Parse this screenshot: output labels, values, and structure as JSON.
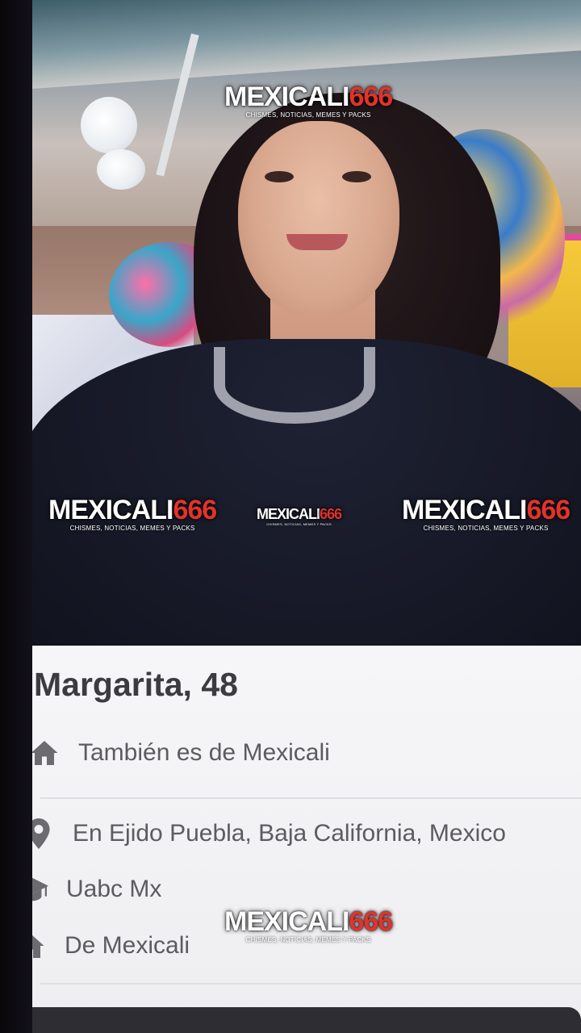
{
  "watermark": {
    "brand_word": "MEXICALI",
    "brand_number": "666",
    "tagline": "CHISMES, NOTICIAS, MEMES Y PACKS"
  },
  "profile": {
    "name_age": "Margarita, 48",
    "details": [
      {
        "icon": "home-icon",
        "text": "También es de Mexicali"
      },
      {
        "icon": "location-pin-icon",
        "text": "En Ejido Puebla, Baja California, Mexico"
      },
      {
        "icon": "graduation-cap-icon",
        "text": "Uabc Mx"
      },
      {
        "icon": "home-icon",
        "text": "De Mexicali"
      }
    ]
  },
  "colors": {
    "brand_red": "#e3322b",
    "card_bg": "#f6f6f8",
    "text_dark": "#3c3c40",
    "text_muted": "#5b5b60",
    "icon_gray": "#6b6b70"
  }
}
